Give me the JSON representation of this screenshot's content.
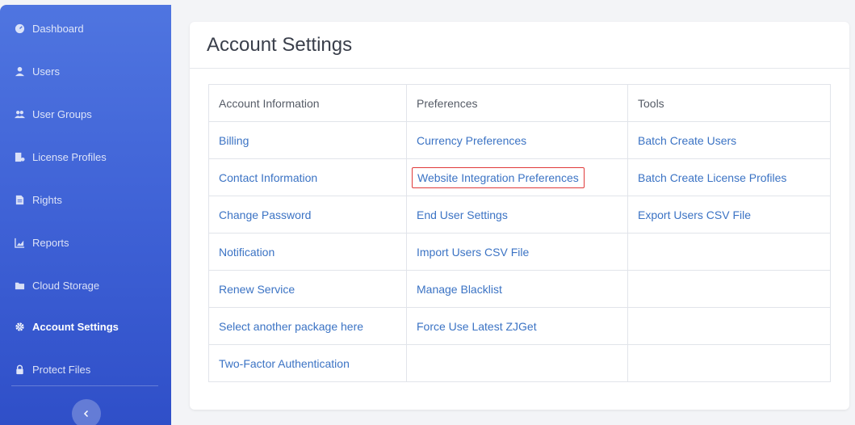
{
  "sidebar": {
    "items": [
      {
        "label": "Dashboard",
        "icon": "dashboard-icon",
        "active": false
      },
      {
        "label": "Users",
        "icon": "user-icon",
        "active": false
      },
      {
        "label": "User Groups",
        "icon": "user-group-icon",
        "active": false
      },
      {
        "label": "License Profiles",
        "icon": "license-profile-icon",
        "active": false
      },
      {
        "label": "Rights",
        "icon": "rights-icon",
        "active": false
      },
      {
        "label": "Reports",
        "icon": "reports-icon",
        "active": false
      },
      {
        "label": "Cloud Storage",
        "icon": "folder-icon",
        "active": false
      },
      {
        "label": "Account Settings",
        "icon": "gear-icon",
        "active": true
      },
      {
        "label": "Protect Files",
        "icon": "lock-icon",
        "active": false
      }
    ],
    "collapse_icon": "chevron-left-icon"
  },
  "card": {
    "title": "Account Settings",
    "columns": [
      "Account Information",
      "Preferences",
      "Tools"
    ],
    "account_information": [
      "Billing",
      "Contact Information",
      "Change Password",
      "Notification",
      "Renew Service",
      "Select another package here",
      "Two-Factor Authentication"
    ],
    "preferences": [
      "Currency Preferences",
      "Website Integration Preferences",
      "End User Settings",
      "Import Users CSV File",
      "Manage Blacklist",
      "Force Use Latest ZJGet"
    ],
    "tools": [
      "Batch Create Users",
      "Batch Create License Profiles",
      "Export Users CSV File"
    ]
  },
  "colors": {
    "sidebar_top": "#4f75e0",
    "sidebar_bottom": "#2f4fc8",
    "link": "#3b73c4",
    "highlight_border": "#e03a3a"
  }
}
